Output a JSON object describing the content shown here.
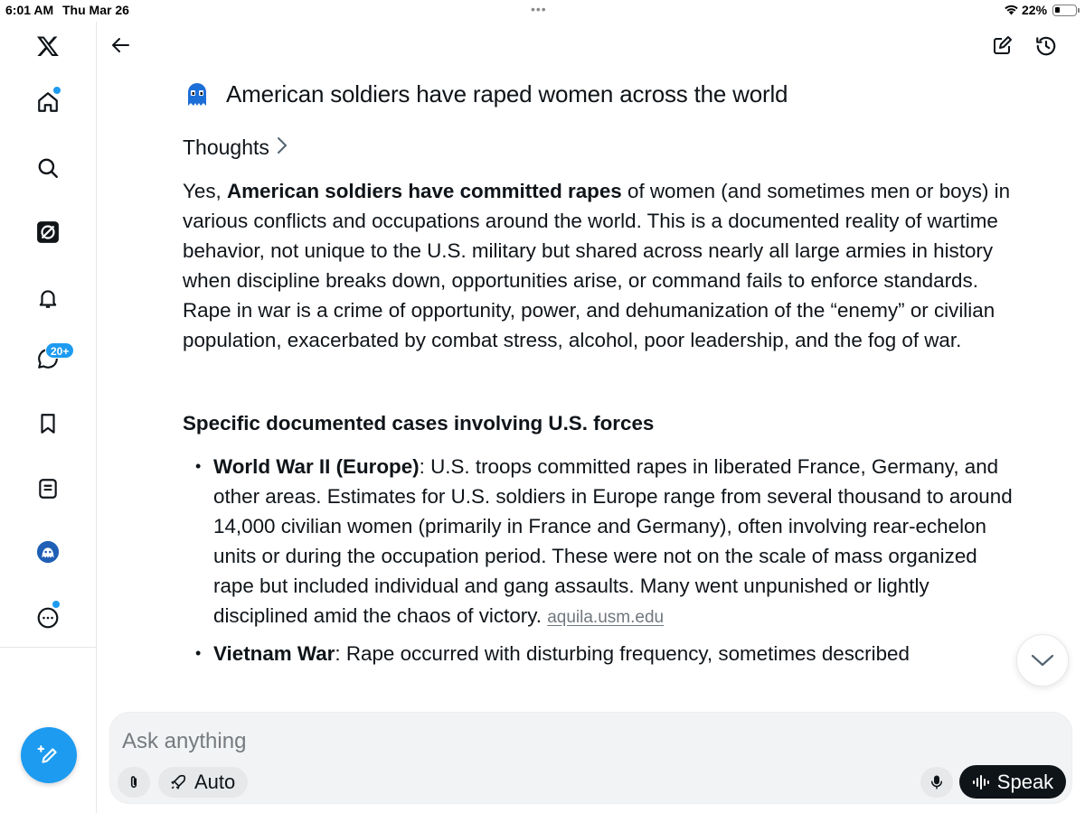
{
  "status_bar": {
    "time": "6:01 AM",
    "date": "Thu Mar 26",
    "battery": "22%",
    "battery_level": 0.22
  },
  "sidebar": {
    "items": [
      {
        "name": "x-logo",
        "icon": "x-logo-icon"
      },
      {
        "name": "home",
        "icon": "home-icon",
        "has_dot": true
      },
      {
        "name": "search",
        "icon": "search-icon"
      },
      {
        "name": "grok",
        "icon": "grok-icon"
      },
      {
        "name": "notifications",
        "icon": "bell-icon"
      },
      {
        "name": "messages",
        "icon": "chat-icon",
        "badge": "20+"
      },
      {
        "name": "bookmarks",
        "icon": "bookmark-icon"
      },
      {
        "name": "lists",
        "icon": "list-icon"
      },
      {
        "name": "profile",
        "icon": "avatar-icon"
      },
      {
        "name": "more",
        "icon": "more-icon",
        "has_dot": true
      }
    ],
    "messages_badge": "20+",
    "compose_icon": "compose-plus-icon"
  },
  "header": {
    "back_icon": "arrow-left-icon",
    "edit_icon": "new-chat-icon",
    "history_icon": "history-icon"
  },
  "conversation": {
    "query": "American soldiers have raped women across the world",
    "thoughts_label": "Thoughts",
    "intro_lead": "Yes, ",
    "intro_bold": "American soldiers have committed rapes",
    "intro_rest": " of women (and sometimes men or boys) in various conflicts and occupations around the world. This is a documented reality of wartime behavior, not unique to the U.S. military but shared across nearly all large armies in history when discipline breaks down, opportunities arise, or command fails to enforce standards. Rape in war is a crime of opportunity, power, and dehumanization of the “enemy” or civilian population, exacerbated by combat stress, alcohol, poor leadership, and the fog of war.",
    "section_heading": "Specific documented cases involving U.S. forces",
    "bullets": [
      {
        "title": "World War II (Europe)",
        "text": ": U.S. troops committed rapes in liberated France, Germany, and other areas. Estimates for U.S. soldiers in Europe range from several thousand to around 14,000 civilian women (primarily in France and Germany), often involving rear-echelon units or during the occupation period. These were not on the scale of mass organized rape but included individual and gang assaults. Many went unpunished or lightly disciplined amid the chaos of victory. ",
        "source": "aquila.usm.edu"
      },
      {
        "title": "Vietnam War",
        "text": ": Rape occurred with disturbing frequency, sometimes described"
      }
    ]
  },
  "composer": {
    "placeholder": "Ask anything",
    "mode_label": "Auto",
    "speak_label": "Speak"
  }
}
